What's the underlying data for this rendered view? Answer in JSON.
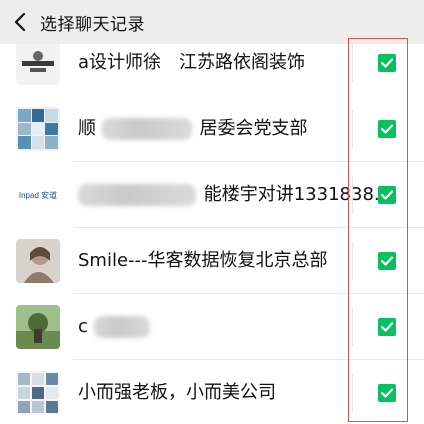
{
  "header": {
    "title": "选择聊天记录",
    "back_icon": "chevron-left-icon"
  },
  "rows": [
    {
      "name": "a设计师徐　江苏路依阁装饰",
      "checked": true
    },
    {
      "name_visible": "顺",
      "name_tail": "居委会党支部",
      "checked": true
    },
    {
      "avatar_text": "Inpad 安道",
      "name_tail": "能楼宇对讲1331838...",
      "checked": true
    },
    {
      "name": "Smile---华客数据恢复北京总部",
      "checked": true
    },
    {
      "name_visible": "c",
      "checked": true
    },
    {
      "name": "小而强老板，小而美公司",
      "checked": true
    }
  ],
  "colors": {
    "accent": "#07c160",
    "topbar": "#ededed",
    "highlight_box": "#d9534f"
  }
}
